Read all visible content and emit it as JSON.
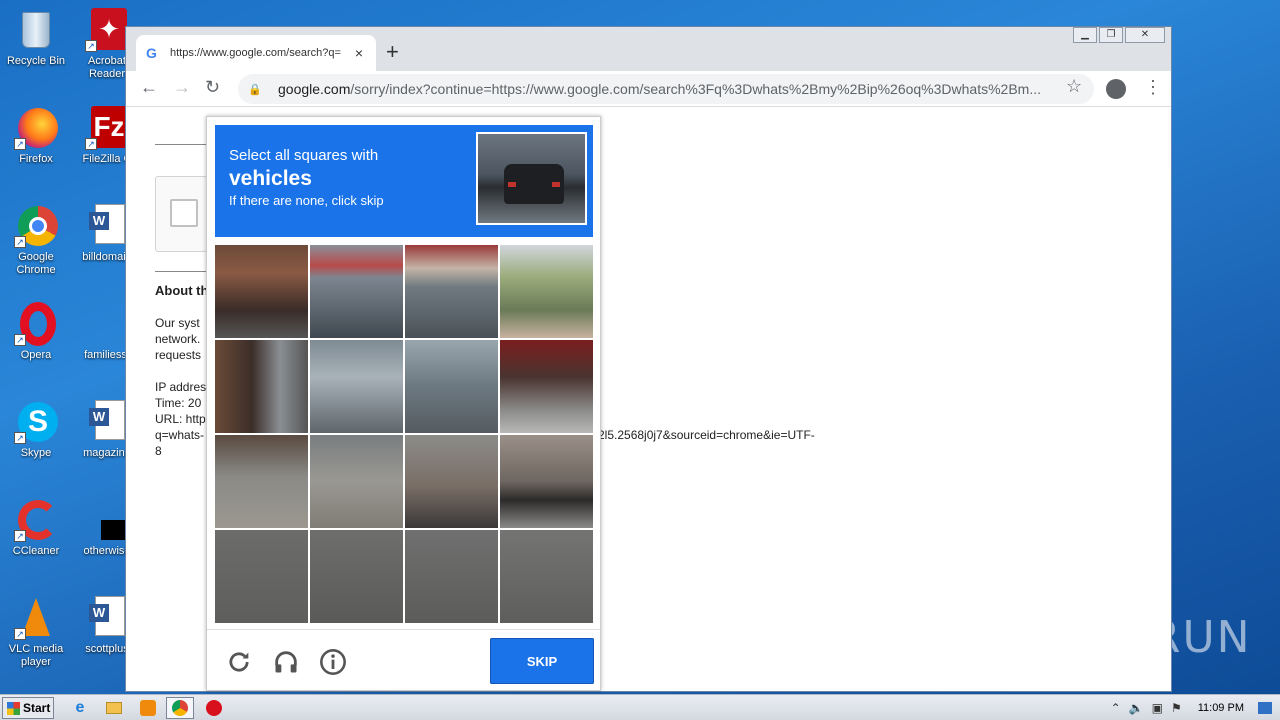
{
  "desktop": {
    "icons_left": [
      {
        "label": "Recycle Bin",
        "icon": "recycle-bin-icon"
      },
      {
        "label": "Firefox",
        "icon": "firefox-icon"
      },
      {
        "label": "Google Chrome",
        "icon": "chrome-icon"
      },
      {
        "label": "Opera",
        "icon": "opera-icon"
      },
      {
        "label": "Skype",
        "icon": "skype-icon"
      },
      {
        "label": "CCleaner",
        "icon": "ccleaner-icon"
      },
      {
        "label": "VLC media player",
        "icon": "vlc-icon"
      }
    ],
    "icons_right": [
      {
        "label": "Acrobat Reader",
        "icon": "acrobat-icon"
      },
      {
        "label": "FileZilla C",
        "icon": "filezilla-icon"
      },
      {
        "label": "billdomain",
        "icon": "word-doc-icon"
      },
      {
        "label": "familiesst",
        "icon": "blank-doc-icon"
      },
      {
        "label": "magazine",
        "icon": "word-doc-icon"
      },
      {
        "label": "otherwise",
        "icon": "black-file-icon"
      },
      {
        "label": "scottplus",
        "icon": "word-doc-icon"
      }
    ]
  },
  "browser": {
    "tab_title": "https://www.google.com/search?q=",
    "url_host": "google.com",
    "url_rest": "/sorry/index?continue=https://www.google.com/search%3Fq%3Dwhats%2Bmy%2Bip%26oq%3Dwhats%2Bm...",
    "tab_close": "×",
    "new_tab": "+"
  },
  "page": {
    "about_heading": "About th",
    "para1": [
      "Our syst",
      "network.",
      "requests"
    ],
    "ip_line": "IP addres",
    "time_line": "Time: 20",
    "url_line": "URL: http",
    "q_line_start": "q=whats-",
    "q_line_end": "2l5.2568j0j7&sourceid=chrome&ie=UTF-",
    "last_line": "8"
  },
  "captcha": {
    "line1": "Select all squares with",
    "line2": "vehicles",
    "line3": "If there are none, click skip",
    "skip_label": "SKIP",
    "colors": {
      "accent": "#1a73e8"
    }
  },
  "watermark": "ANY RUN",
  "taskbar": {
    "start_label": "Start",
    "clock": "11:09 PM"
  }
}
